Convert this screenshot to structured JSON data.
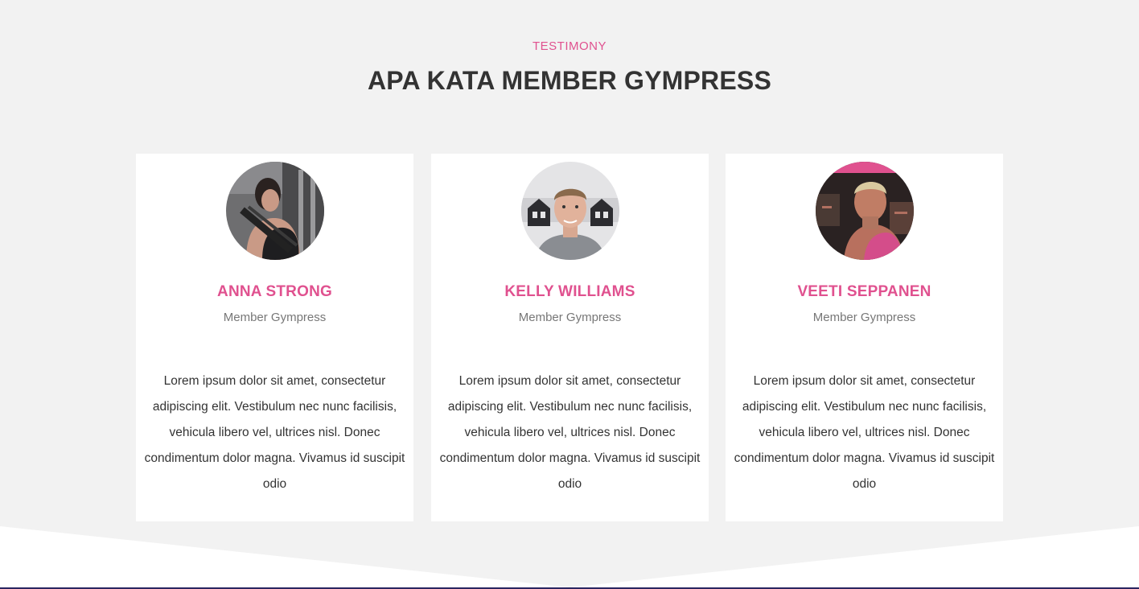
{
  "section": {
    "eyebrow": "TESTIMONY",
    "title": "APA KATA MEMBER GYMPRESS"
  },
  "testimonials": [
    {
      "name": "ANNA STRONG",
      "role": "Member Gympress",
      "quote": "Lorem ipsum dolor sit amet, consectetur adipiscing elit. Vestibulum nec nunc facilisis, vehicula libero vel, ultrices nisl. Donec condimentum dolor magna. Vivamus id suscipit odio",
      "avatar": "woman-with-rope-photo"
    },
    {
      "name": "KELLY WILLIAMS",
      "role": "Member Gympress",
      "quote": "Lorem ipsum dolor sit amet, consectetur adipiscing elit. Vestibulum nec nunc facilisis, vehicula libero vel, ultrices nisl. Donec condimentum dolor magna. Vivamus id suscipit odio",
      "avatar": "young-man-portrait-photo"
    },
    {
      "name": "VEETI SEPPANEN",
      "role": "Member Gympress",
      "quote": "Lorem ipsum dolor sit amet, consectetur adipiscing elit. Vestibulum nec nunc facilisis, vehicula libero vel, ultrices nisl. Donec condimentum dolor magna. Vivamus id suscipit odio",
      "avatar": "muscular-man-gym-photo"
    }
  ],
  "colors": {
    "accent": "#e0518f",
    "background": "#f2f2f2",
    "card": "#ffffff",
    "heading": "#333333",
    "muted": "#777777"
  }
}
